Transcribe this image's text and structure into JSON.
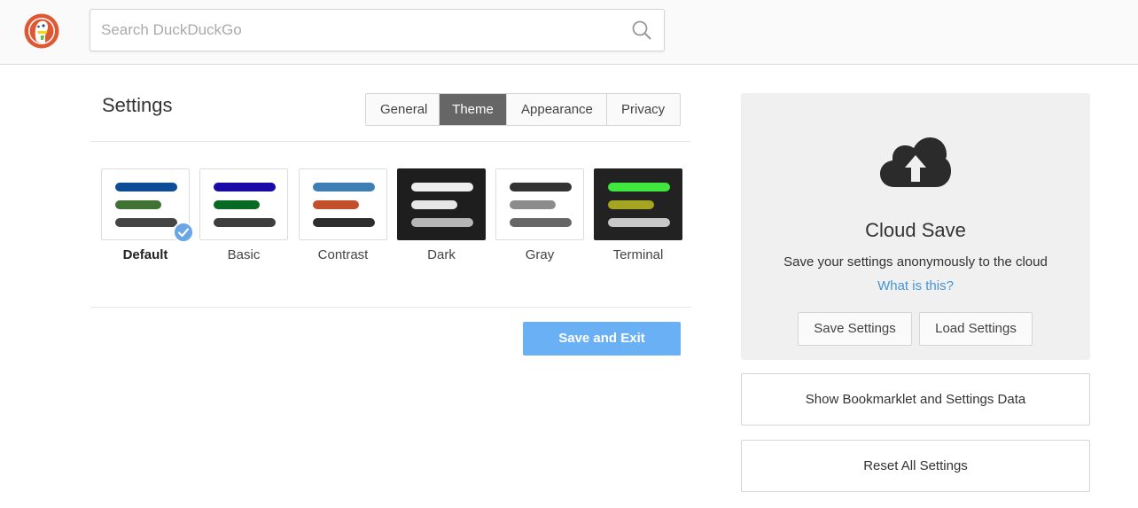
{
  "header": {
    "search_placeholder": "Search DuckDuckGo"
  },
  "settings": {
    "title": "Settings",
    "tabs": [
      {
        "label": "General",
        "active": false
      },
      {
        "label": "Theme",
        "active": true
      },
      {
        "label": "Appearance",
        "active": false
      },
      {
        "label": "Privacy",
        "active": false
      }
    ],
    "themes": [
      {
        "label": "Default",
        "selected": true,
        "bg": "#ffffff",
        "bars": [
          "#0d4c96",
          "#3f7233",
          "#454545"
        ]
      },
      {
        "label": "Basic",
        "selected": false,
        "bg": "#ffffff",
        "bars": [
          "#1a0aa8",
          "#066a23",
          "#3e3e3e"
        ]
      },
      {
        "label": "Contrast",
        "selected": false,
        "bg": "#ffffff",
        "bars": [
          "#3d7fb4",
          "#c2502a",
          "#2d2d2d"
        ]
      },
      {
        "label": "Dark",
        "selected": false,
        "bg": "#1e1e1e",
        "bars": [
          "#eeeeee",
          "#e6e6e6",
          "#b6b6b6"
        ]
      },
      {
        "label": "Gray",
        "selected": false,
        "bg": "#ffffff",
        "bars": [
          "#333333",
          "#8c8c8c",
          "#666666"
        ]
      },
      {
        "label": "Terminal",
        "selected": false,
        "bg": "#222222",
        "bars": [
          "#3ee63e",
          "#a5a521",
          "#c8c8c8"
        ]
      }
    ],
    "save_exit_label": "Save and Exit"
  },
  "cloud": {
    "title": "Cloud Save",
    "description": "Save your settings anonymously to the cloud",
    "link": "What is this?",
    "save_label": "Save Settings",
    "load_label": "Load Settings"
  },
  "bookmarklet_label": "Show Bookmarklet and Settings Data",
  "reset_label": "Reset All Settings",
  "colors": {
    "accent": "#6ab0f5",
    "link": "#4495d4",
    "active_tab": "#666666",
    "logo": "#de5833"
  }
}
